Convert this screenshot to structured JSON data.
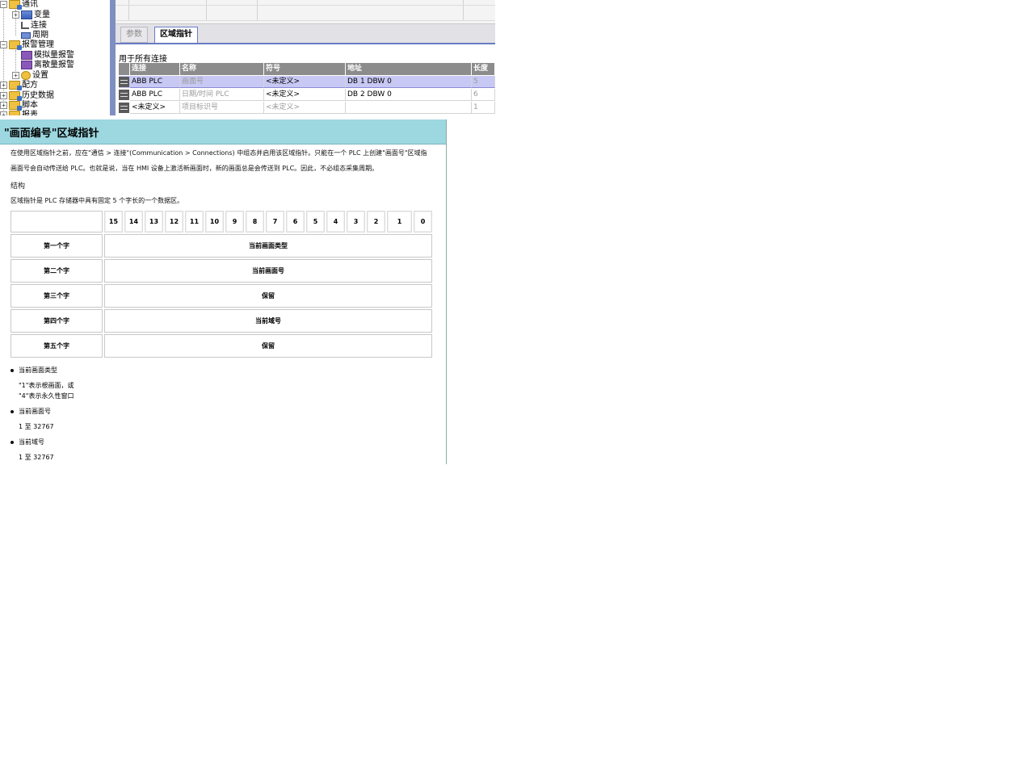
{
  "tree": {
    "items": [
      {
        "label": "通讯",
        "icon": "folder-icon"
      },
      {
        "label": "变量",
        "icon": "tags-icon"
      },
      {
        "label": "连接",
        "icon": "connection-icon"
      },
      {
        "label": "周期",
        "icon": "cycle-icon"
      },
      {
        "label": "报警管理",
        "icon": "folder-icon"
      },
      {
        "label": "模拟量报警",
        "icon": "alarm-icon"
      },
      {
        "label": "离散量报警",
        "icon": "alarm-icon"
      },
      {
        "label": "设置",
        "icon": "settings-icon"
      },
      {
        "label": "配方",
        "icon": "folder-icon"
      },
      {
        "label": "历史数据",
        "icon": "folder-icon"
      },
      {
        "label": "脚本",
        "icon": "folder-icon"
      },
      {
        "label": "报表",
        "icon": "folder-icon"
      }
    ]
  },
  "tabs": {
    "params": "参数",
    "area_pointer": "区域指针"
  },
  "pointer_panel": {
    "caption": "用于所有连接",
    "columns": [
      "连接",
      "名称",
      "符号",
      "地址",
      "长度"
    ],
    "rows": [
      {
        "connection": "ABB PLC",
        "name": "画面号",
        "symbol": "<未定义>",
        "address": "DB 1 DBW 0",
        "length": "5"
      },
      {
        "connection": "ABB PLC",
        "name": "日期/时间 PLC",
        "symbol": "<未定义>",
        "address": "DB 2 DBW 0",
        "length": "6"
      },
      {
        "connection": "<未定义>",
        "name": "项目标识号",
        "symbol": "<未定义>",
        "address": "",
        "length": "1"
      }
    ]
  },
  "help": {
    "title": "\"画面编号\"区域指针",
    "para1": "在使用区域指针之前，应在\"通信 > 连接\"(Communication > Connections) 中组态并启用该区域指针。只能在一个 PLC 上创建\"画面号\"区域指",
    "para2": "画面号会自动传送给 PLC。也就是说，当在 HMI 设备上激活新画面时，新的画面总是会传送到 PLC。因此，不必组态采集周期。",
    "heading": "结构",
    "para3": "区域指针是 PLC 存储器中具有固定 5 个字长的一个数据区。",
    "bits": [
      "15",
      "14",
      "13",
      "12",
      "11",
      "10",
      "9",
      "8",
      "7",
      "6",
      "5",
      "4",
      "3",
      "2",
      "1",
      "0"
    ],
    "words": [
      {
        "label": "第一个字",
        "content": "当前画面类型"
      },
      {
        "label": "第二个字",
        "content": "当前画面号"
      },
      {
        "label": "第三个字",
        "content": "保留"
      },
      {
        "label": "第四个字",
        "content": "当前域号"
      },
      {
        "label": "第五个字",
        "content": "保留"
      }
    ],
    "b1_title": "当前画面类型",
    "b1_line1": "\"1\"表示根画面，或",
    "b1_line2": "\"4\"表示永久性窗口",
    "b2_title": "当前画面号",
    "b2_value": "1 至 32767",
    "b3_title": "当前域号",
    "b3_value": "1 至 32767"
  }
}
